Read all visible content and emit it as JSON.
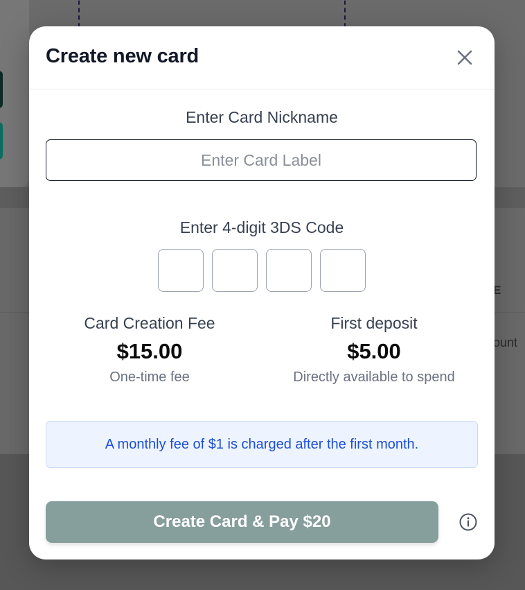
{
  "background": {
    "table_column_fragment": "E",
    "table_cell_fragment": "ount"
  },
  "modal": {
    "title": "Create new card",
    "close_icon": "close-icon",
    "nickname": {
      "label": "Enter Card Nickname",
      "placeholder": "Enter Card Label",
      "value": ""
    },
    "code": {
      "label": "Enter 4-digit 3DS Code",
      "digits": [
        "",
        "",
        "",
        ""
      ]
    },
    "fees": {
      "creation": {
        "title": "Card Creation Fee",
        "amount": "$15.00",
        "note": "One-time fee"
      },
      "deposit": {
        "title": "First deposit",
        "amount": "$5.00",
        "note": "Directly available to spend"
      }
    },
    "notice": "A monthly fee of $1 is charged after the first month.",
    "submit_label": "Create Card & Pay $20",
    "info_icon": "info-icon"
  },
  "colors": {
    "overlay": "#6a6a6a",
    "primary_button": "#869e9c",
    "notice_bg": "#eef4ff",
    "notice_text": "#1d4ed8",
    "title_text": "#111827"
  }
}
